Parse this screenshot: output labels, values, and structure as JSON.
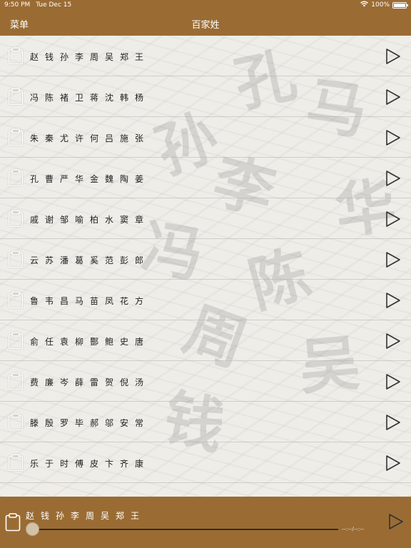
{
  "status": {
    "time": "9:50 PM",
    "date": "Tue Dec 15",
    "battery": "100%",
    "wifi_icon": "wifi-icon",
    "battery_icon": "battery-icon"
  },
  "nav": {
    "menu_label": "菜单",
    "title": "百家姓"
  },
  "background_glyphs": [
    "孔",
    "马",
    "孙",
    "李",
    "华",
    "冯",
    "陈",
    "周",
    "吴",
    "钱"
  ],
  "rows": [
    {
      "text": "赵钱孙李周吴郑王"
    },
    {
      "text": "冯陈褚卫蒋沈韩杨"
    },
    {
      "text": "朱秦尤许何吕施张"
    },
    {
      "text": "孔曹严华金魏陶姜"
    },
    {
      "text": "戚谢邹喻柏水窦章"
    },
    {
      "text": "云苏潘葛奚范彭郎"
    },
    {
      "text": "鲁韦昌马苗凤花方"
    },
    {
      "text": "俞任袁柳酆鲍史唐"
    },
    {
      "text": "费廉岑薛雷贺倪汤"
    },
    {
      "text": "滕殷罗毕郝邬安常"
    },
    {
      "text": "乐于时傅皮卞齐康"
    }
  ],
  "player": {
    "current": "赵钱孙李周吴郑王",
    "time_label": "--:--/--:--",
    "progress": 0
  },
  "colors": {
    "brand": "#9a6c34",
    "icon": "#ffffff",
    "play_icon": "#333333"
  }
}
